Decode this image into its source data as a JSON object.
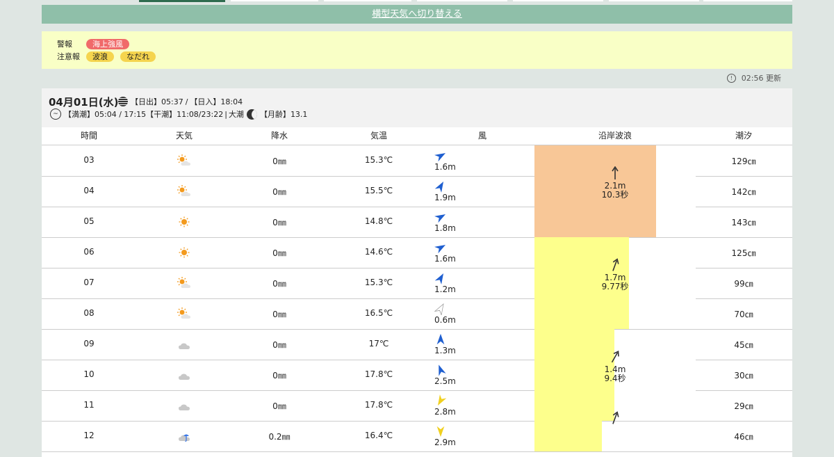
{
  "toggle_link": "横型天気へ切り替える",
  "alerts": {
    "warning_label": "警報",
    "warning_badges": [
      "海上強風"
    ],
    "advisory_label": "注意報",
    "advisory_badges": [
      "波浪",
      "なだれ"
    ]
  },
  "updated": "02:56 更新",
  "day": {
    "date": "04月01日(水)",
    "sunrise_label": "【日出】",
    "sunrise": "05:37",
    "sunset_label": "【日入】",
    "sunset": "18:04",
    "high_tide_label": "【満潮】",
    "high_tide": "05:04 / 17:15",
    "low_tide_label": "【干潮】",
    "low_tide": "11:08/23:22",
    "tide_type": "大潮",
    "moon_age_label": "【月齢】",
    "moon_age": "13.1"
  },
  "columns": [
    "時間",
    "天気",
    "降水",
    "気温",
    "風",
    "沿岸波浪",
    "潮汐"
  ],
  "rows": [
    {
      "time": "03",
      "weather": "sunny-cloudy",
      "precip": "0㎜",
      "temp": "15.3℃",
      "wind_speed": "1.6m",
      "wind_dir": 60,
      "wind_color": "#1f5fd0",
      "tide": "129㎝"
    },
    {
      "time": "04",
      "weather": "sunny-cloudy",
      "precip": "0㎜",
      "temp": "15.5℃",
      "wind_speed": "1.9m",
      "wind_dir": 30,
      "wind_color": "#1f5fd0",
      "tide": "142㎝"
    },
    {
      "time": "05",
      "weather": "sunny",
      "precip": "0㎜",
      "temp": "14.8℃",
      "wind_speed": "1.8m",
      "wind_dir": 60,
      "wind_color": "#1f5fd0",
      "tide": "143㎝"
    },
    {
      "time": "06",
      "weather": "sunny",
      "precip": "0㎜",
      "temp": "14.6℃",
      "wind_speed": "1.6m",
      "wind_dir": 60,
      "wind_color": "#1f5fd0",
      "tide": "125㎝"
    },
    {
      "time": "07",
      "weather": "sunny-cloudy",
      "precip": "0㎜",
      "temp": "15.3℃",
      "wind_speed": "1.2m",
      "wind_dir": 30,
      "wind_color": "#1f5fd0",
      "tide": "99㎝"
    },
    {
      "time": "08",
      "weather": "sunny-cloudy",
      "precip": "0㎜",
      "temp": "16.5℃",
      "wind_speed": "0.6m",
      "wind_dir": 30,
      "wind_color": "#ffffff",
      "tide": "70㎝"
    },
    {
      "time": "09",
      "weather": "cloudy",
      "precip": "0㎜",
      "temp": "17℃",
      "wind_speed": "1.3m",
      "wind_dir": 0,
      "wind_color": "#1f5fd0",
      "tide": "45㎝"
    },
    {
      "time": "10",
      "weather": "cloudy",
      "precip": "0㎜",
      "temp": "17.8℃",
      "wind_speed": "2.5m",
      "wind_dir": -20,
      "wind_color": "#1f5fd0",
      "tide": "30㎝"
    },
    {
      "time": "11",
      "weather": "cloudy",
      "precip": "0㎜",
      "temp": "17.8℃",
      "wind_speed": "2.8m",
      "wind_dir": -150,
      "wind_color": "#f0d020",
      "tide": "29㎝"
    },
    {
      "time": "12",
      "weather": "rain",
      "precip": "0.2㎜",
      "temp": "16.4℃",
      "wind_speed": "2.9m",
      "wind_dir": 180,
      "wind_color": "#f0d020",
      "tide": "46㎝"
    }
  ],
  "waves": [
    {
      "height": "2.1m",
      "period": "10.3秒",
      "rows": 3,
      "level": 0.76,
      "color": "#f8c797",
      "dir": 0
    },
    {
      "height": "1.7m",
      "period": "9.77秒",
      "rows": 3,
      "level": 0.59,
      "color": "#fdff8c",
      "dir": 20
    },
    {
      "height": "1.4m",
      "period": "9.4秒",
      "rows": 3,
      "level": 0.5,
      "color": "#fdff8c",
      "dir": 30
    },
    {
      "height": "",
      "period": "",
      "rows": 1,
      "level": 0.42,
      "color": "#fdff8c",
      "dir": 20
    }
  ]
}
